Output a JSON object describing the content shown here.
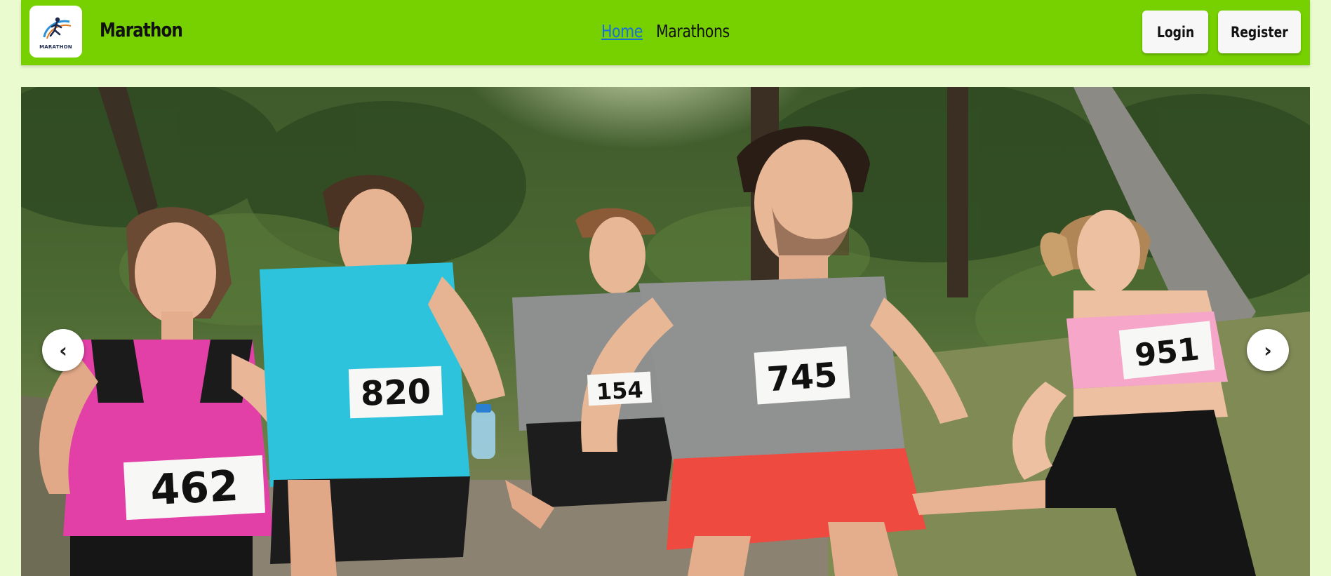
{
  "navbar": {
    "logo_text": "MARATHON",
    "brand": "Marathon",
    "links": [
      {
        "label": "Home",
        "active": true
      },
      {
        "label": "Marathons",
        "active": false
      }
    ],
    "login_label": "Login",
    "register_label": "Register"
  },
  "carousel": {
    "image_alt": "Group of runners racing along a forest trail",
    "prev_icon": "‹",
    "next_icon": "›",
    "bibs": [
      "462",
      "820",
      "154",
      "745",
      "951"
    ]
  },
  "colors": {
    "page_bg": "#ebfbd0",
    "navbar_bg": "#77d000",
    "active_link": "#1a6ed8"
  }
}
